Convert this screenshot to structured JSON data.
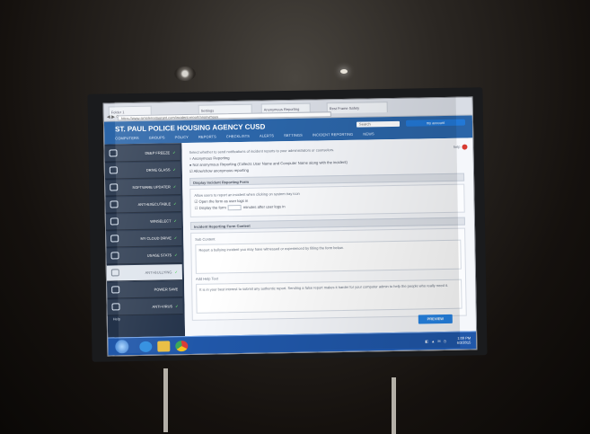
{
  "browser": {
    "tabs": [
      "Folder 1",
      "Settings",
      "Anonymous Reporting",
      "Rest Frame Safety"
    ],
    "address": "https://www.simplerestaurant.com/incident-report/anonymous"
  },
  "app": {
    "title": "ST. PAUL POLICE HOUSING AGENCY CUSD",
    "nav": [
      "COMPUTERS",
      "GROUPS",
      "POLICY",
      "REPORTS",
      "CHECKLISTS",
      "ALERTS",
      "SETTINGS",
      "INCIDENT REPORTING",
      "NEWS"
    ],
    "search_placeholder": "Search",
    "account": "my account"
  },
  "sidebar": {
    "items": [
      "DEEP FREEZE",
      "DRIVE GLASS",
      "SOFTWARE UPDATER",
      "ANTI-EXECUTABLE",
      "WINSELECT",
      "MY CLOUD DRIVE",
      "USAGE STATS",
      "ANTI-BULLYING",
      "POWER SAVE",
      "ANTI-VIRUS"
    ],
    "help": "Help"
  },
  "content": {
    "top_text": "Select whether to send notifications of incident reports to your administrators or counselors.",
    "option1": "Anonymous Reporting",
    "option2": "Not anonymous Reporting (Collects User Name and Computer Name along with the incident)",
    "option3": "Allow/show anonymous reporting",
    "section1_title": "Display Incident Reporting Form",
    "section1_text": "Allow users to report an incident when clicking on system tray icon",
    "checkbox1": "Open the form as user logs in",
    "checkbox2_prefix": "Display the form",
    "checkbox2_suffix": "minutes after user logs in",
    "section2_title": "Incident Reporting Form Content",
    "subtitle": "Sub Content",
    "content_text": "Report a bullying incident you may have witnessed or experienced by filling the form below.",
    "help_label": "Add Help Text",
    "help_text": "It is in your best interest to submit any authentic report. Sending a false report makes it harder for your computer admin to help the people who really need it.",
    "preview": "PREVIEW",
    "toolbar": "help"
  },
  "taskbar": {
    "clock_time": "1:09 PM",
    "clock_date": "6/2/2015",
    "tray": "◧ ▲ ✉ ◷"
  },
  "colors": {
    "header_blue": "#2b65a8",
    "sidebar_dark": "#233249",
    "success_green": "#62d66d",
    "preview_blue": "#2684e5"
  }
}
